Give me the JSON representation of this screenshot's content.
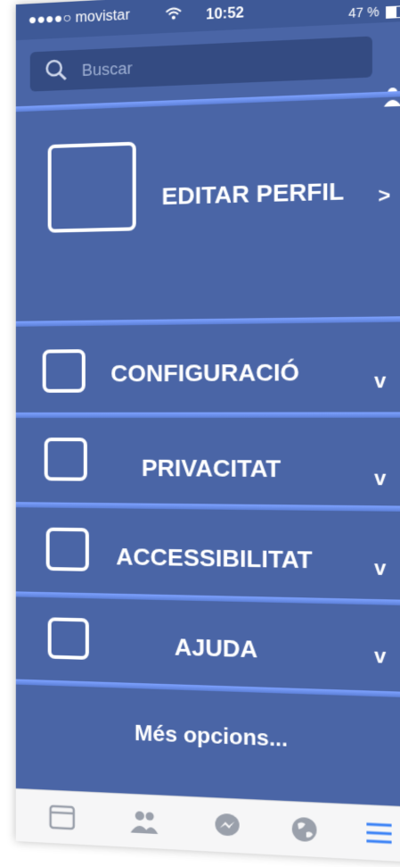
{
  "status_bar": {
    "carrier": "●●●●○ movistar",
    "time": "10:52",
    "battery_percent": "47 %",
    "battery_level": 0.47
  },
  "search": {
    "placeholder": "Buscar"
  },
  "profile": {
    "label": "EDITAR PERFIL",
    "chevron": ">"
  },
  "menu": {
    "items": [
      {
        "label": "CONFIGURACIÓ",
        "chevron": "v"
      },
      {
        "label": "PRIVACITAT",
        "chevron": "v"
      },
      {
        "label": "ACCESSIBILITAT",
        "chevron": "v"
      },
      {
        "label": "AJUDA",
        "chevron": "v"
      }
    ]
  },
  "more_options": "Més opcions...",
  "tabbar": {
    "icons": [
      "news-feed-icon",
      "friends-icon",
      "messenger-icon",
      "globe-icon",
      "menu-icon"
    ],
    "active_color": "#3b82f6",
    "inactive_color": "#9aa0ab"
  },
  "colors": {
    "background": "#4a65a6",
    "band": "#7ea2ff"
  }
}
